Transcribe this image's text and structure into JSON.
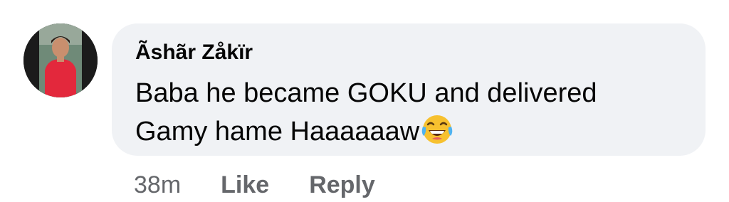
{
  "comment": {
    "author": "Ãshãr Zåkïr",
    "line1": "Baba he became GOKU and delivered",
    "line2": "Gamy hame Haaaaaaw",
    "emoji": "face-with-tears-of-joy-icon"
  },
  "actions": {
    "timestamp": "38m",
    "like_label": "Like",
    "reply_label": "Reply"
  },
  "colors": {
    "bubble": "#f0f2f5",
    "text": "#050505",
    "muted": "#65676b"
  }
}
